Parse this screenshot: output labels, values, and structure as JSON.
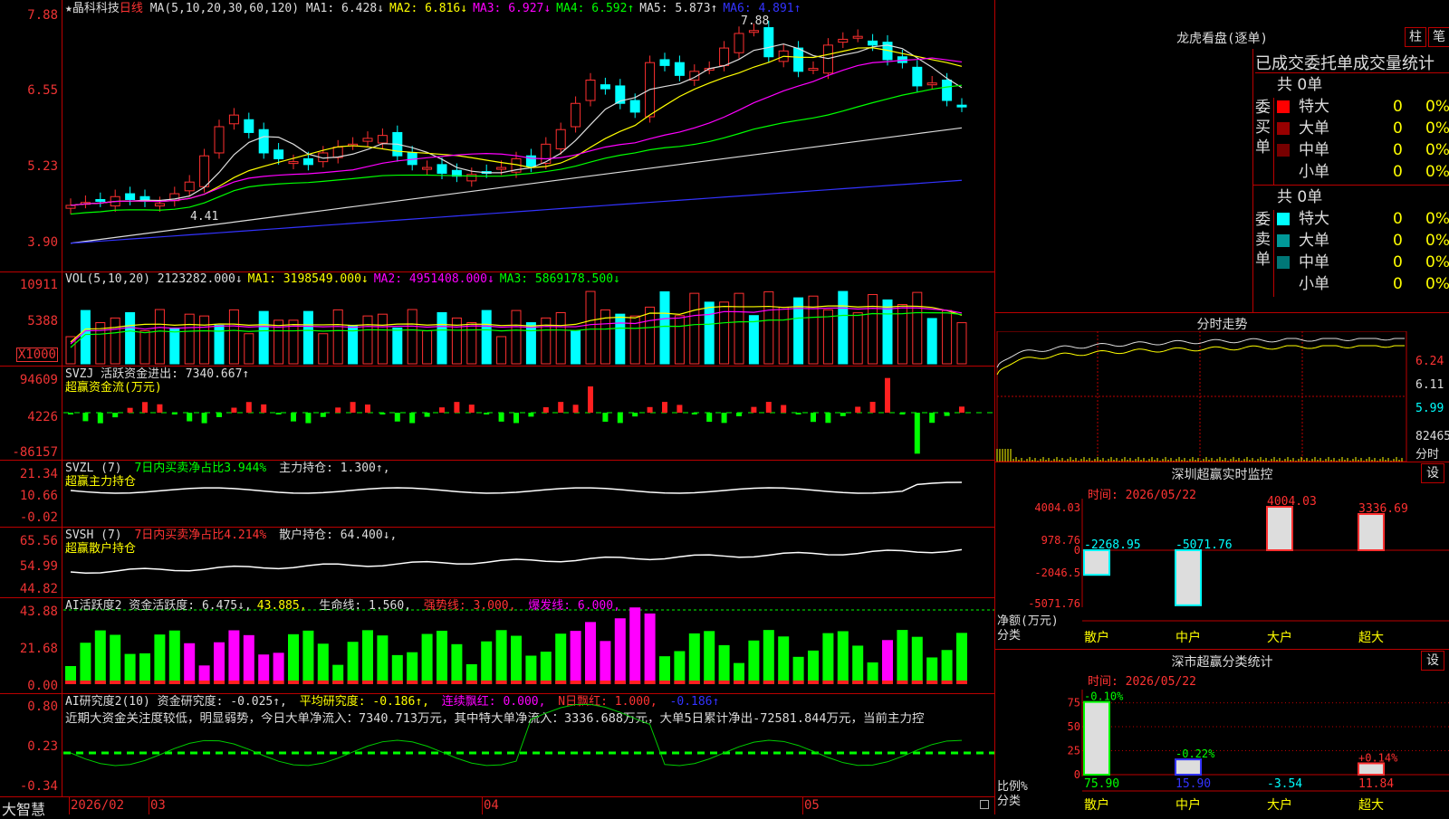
{
  "stock": {
    "name": "晶科科技",
    "period": "日线",
    "star": "★"
  },
  "panels": {
    "price": {
      "title": "MA(5,10,20,30,60,120)",
      "ma": [
        {
          "label": "MA1: 6.428↓",
          "color": "#dddddd"
        },
        {
          "label": "MA2: 6.816↓",
          "color": "#ffff00"
        },
        {
          "label": "MA3: 6.927↓",
          "color": "#ff00ff"
        },
        {
          "label": "MA4: 6.592↑",
          "color": "#00ff00"
        },
        {
          "label": "MA5: 5.873↑",
          "color": "#dddddd"
        },
        {
          "label": "MA6: 4.891↑",
          "color": "#3333ff"
        }
      ],
      "yticks": [
        "7.88",
        "6.55",
        "5.23",
        "3.90"
      ],
      "high_label": "7.88",
      "low_label": "4.41"
    },
    "vol": {
      "title": "VOL(5,10,20)",
      "values": [
        {
          "label": "2123282.000↓",
          "color": "#dddddd"
        },
        {
          "label": "MA1: 3198549.000↓",
          "color": "#ffff00"
        },
        {
          "label": "MA2: 4951408.000↓",
          "color": "#ff00ff"
        },
        {
          "label": "MA3: 5869178.500↓",
          "color": "#00ff00"
        }
      ],
      "yticks": [
        "10911",
        "5388"
      ],
      "unit": "X1000"
    },
    "svzj": {
      "line1": [
        {
          "label": "SVZJ  活跃资金进出: 7340.667↑",
          "color": "#dddddd"
        }
      ],
      "line2": "超赢资金流(万元)",
      "yticks": [
        "94609",
        "4226",
        "-86157"
      ]
    },
    "svzl": {
      "line1": [
        {
          "label": "SVZL (7) ",
          "color": "#dddddd"
        },
        {
          "label": "7日内买卖净占比3.944%",
          "color": "#00ff00"
        },
        {
          "label": " 主力持仓: 1.300↑,",
          "color": "#dddddd"
        }
      ],
      "line2": "超赢主力持仓",
      "yticks": [
        "21.34",
        "10.66",
        "-0.02"
      ]
    },
    "svsh": {
      "line1": [
        {
          "label": "SVSH (7) ",
          "color": "#dddddd"
        },
        {
          "label": "7日内买卖净占比4.214%",
          "color": "#ff3333"
        },
        {
          "label": " 散户持仓: 64.400↓,",
          "color": "#dddddd"
        }
      ],
      "line2": "超赢散户持仓",
      "yticks": [
        "65.56",
        "54.99",
        "44.82"
      ]
    },
    "ai_active": {
      "line1": [
        {
          "label": "AI活跃度2 资金活跃度: 6.475↓,",
          "color": "#dddddd"
        },
        {
          "label": "43.885,",
          "color": "#ffff00"
        },
        {
          "label": " 生命线: 1.560,",
          "color": "#dddddd"
        },
        {
          "label": " 强势线: 3.000,",
          "color": "#ff3333"
        },
        {
          "label": " 爆发线: 6.000,",
          "color": "#ff00ff"
        }
      ],
      "yticks": [
        "43.88",
        "21.68",
        "0.00"
      ]
    },
    "ai_research": {
      "line1": [
        {
          "label": "AI研究度2(10) 资金研究度: -0.025↑,",
          "color": "#dddddd"
        },
        {
          "label": " 平均研究度: -0.186↑,",
          "color": "#ffff00"
        },
        {
          "label": " 连续飘红: 0.000,",
          "color": "#ff00ff"
        },
        {
          "label": " N日飘红: 1.000,",
          "color": "#ff3333"
        },
        {
          "label": " -0.186↑",
          "color": "#3333ff"
        }
      ],
      "comment": "近期大资金关注度较低，明显弱势，今日大单净流入：7340.713万元，其中特大单净流入：3336.688万元，大单5日累计净出-72581.844万元，当前主力控",
      "yticks": [
        "0.80",
        "0.23",
        "-0.34"
      ]
    }
  },
  "xaxis": {
    "labels": [
      "2026/02",
      "03",
      "04",
      "05"
    ],
    "brand": "大智慧"
  },
  "right": {
    "dragon_tiger": {
      "title": "龙虎看盘(逐单)",
      "btn1": "柱",
      "btn2": "笔",
      "header": "已成交委托单成交量统计"
    },
    "buy": {
      "label": "委买单",
      "total": "共 0单",
      "rows": [
        {
          "name": "特大",
          "color": "#ff0000",
          "val": "0",
          "pct": "0%"
        },
        {
          "name": "大单",
          "color": "#990000",
          "val": "0",
          "pct": "0%"
        },
        {
          "name": "中单",
          "color": "#770000",
          "val": "0",
          "pct": "0%"
        },
        {
          "name": "小单",
          "color": "#000000",
          "val": "0",
          "pct": "0%"
        }
      ]
    },
    "sell": {
      "label": "委卖单",
      "total": "共 0单",
      "rows": [
        {
          "name": "特大",
          "color": "#00ffff",
          "val": "0",
          "pct": "0%"
        },
        {
          "name": "大单",
          "color": "#009999",
          "val": "0",
          "pct": "0%"
        },
        {
          "name": "中单",
          "color": "#007777",
          "val": "0",
          "pct": "0%"
        },
        {
          "name": "小单",
          "color": "#000000",
          "val": "0",
          "pct": "0%"
        }
      ]
    },
    "intraday": {
      "title": "分时走势",
      "prices": [
        "6.24",
        "6.11",
        "5.99"
      ],
      "vol": "82465",
      "unit": "分时"
    },
    "monitor": {
      "title": "深圳超赢实时监控",
      "btn": "设",
      "time": "时间: 2026/05/22",
      "yticks": [
        "4004.03",
        "978.76",
        "0",
        "-2046.5",
        "-5071.76"
      ],
      "ylabel1": "净额(万元)",
      "ylabel2": "分类",
      "categories": [
        "散户",
        "中户",
        "大户",
        "超大"
      ],
      "values": [
        -2268.95,
        -5071.76,
        4004.03,
        3336.69
      ],
      "value_labels": [
        "-2268.95",
        "-5071.76",
        "4004.03",
        "3336.69"
      ]
    },
    "classify": {
      "title": "深市超赢分类统计",
      "btn": "设",
      "time": "时间: 2026/05/22",
      "yticks": [
        "75",
        "50",
        "25",
        "0"
      ],
      "ylabel1": "比例%",
      "ylabel2": "分类",
      "categories": [
        "散户",
        "中户",
        "大户",
        "超大"
      ],
      "values": [
        75.9,
        15.9,
        -3.54,
        11.84
      ],
      "value_labels": [
        "75.90",
        "15.90",
        "-3.54",
        "11.84"
      ],
      "change_labels": [
        "-0.10%",
        "-0.22%",
        "",
        "+0.14%"
      ]
    }
  }
}
